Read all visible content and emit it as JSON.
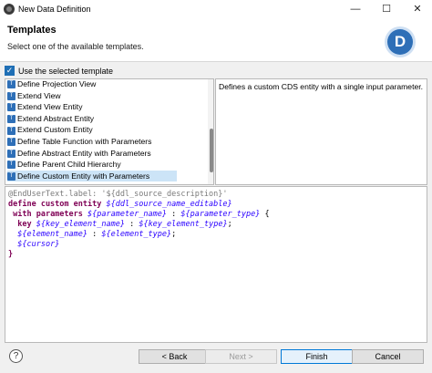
{
  "window": {
    "title": "New Data Definition",
    "minimize_glyph": "—",
    "maximize_glyph": "☐",
    "close_glyph": "✕"
  },
  "header": {
    "title": "Templates",
    "description": "Select one of the available templates.",
    "badge_letter": "D"
  },
  "use_template": {
    "label": "Use the selected template",
    "checked": true,
    "check_glyph": "✓"
  },
  "template_list": {
    "icon_letter": "T",
    "items": [
      {
        "label": "Define Projection View"
      },
      {
        "label": "Extend View"
      },
      {
        "label": "Extend View Entity"
      },
      {
        "label": "Extend Abstract Entity"
      },
      {
        "label": "Extend Custom Entity"
      },
      {
        "label": "Define Table Function with Parameters"
      },
      {
        "label": "Define Abstract Entity with Parameters"
      },
      {
        "label": "Define Parent Child Hierarchy"
      },
      {
        "label": "Define Custom Entity with Parameters",
        "selected": true
      }
    ]
  },
  "template_description": "Defines a custom CDS entity with a single input parameter.",
  "code": {
    "line1": {
      "anno": "@EndUserText.label: '${ddl_source_description}'"
    },
    "line2": {
      "kw": "define custom entity ",
      "ph": "${ddl_source_name_editable}"
    },
    "line3": {
      "indent": " ",
      "kw": "with parameters ",
      "ph1": "${parameter_name}",
      "sep": " : ",
      "ph2": "${parameter_type}",
      "end": " {"
    },
    "line4": {
      "indent": "  ",
      "kw": "key ",
      "ph1": "${key_element_name}",
      "sep": " : ",
      "ph2": "${key_element_type}",
      "end": ";"
    },
    "line5": {
      "indent": "  ",
      "ph1": "${element_name}",
      "sep": " : ",
      "ph2": "${element_type}",
      "end": ";"
    },
    "line6": {
      "indent": "  ",
      "ph": "${cursor}"
    },
    "line7": {
      "pl": "}"
    }
  },
  "buttons": {
    "help": "?",
    "back": "< Back",
    "next": "Next >",
    "finish": "Finish",
    "cancel": "Cancel"
  },
  "colors": {
    "accent": "#0078d7",
    "keyword": "#7f0055",
    "placeholder": "#2a00ff",
    "annotation": "#7a7a7a",
    "selection": "#cce4f7"
  }
}
